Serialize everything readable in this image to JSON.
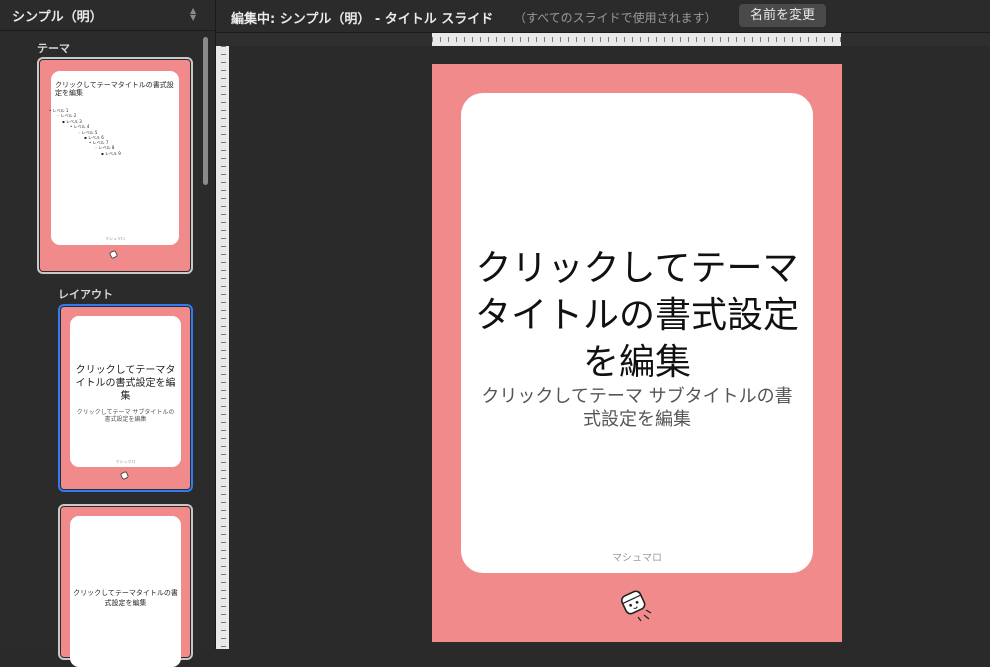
{
  "sidebar": {
    "theme_name": "シンプル（明）",
    "theme_section_label": "テーマ",
    "layout_section_label": "レイアウト",
    "thumbnails": [
      {
        "title": "クリックしてテーマタイトルの書式設定を編集",
        "levels": [
          "• レベル 1",
          "◦ レベル 2",
          "▪ レベル 3",
          "• レベル 4",
          "◦ レベル 5",
          "▪ レベル 6",
          "• レベル 7",
          "◦ レベル 8",
          "▪ レベル 9"
        ],
        "footer": "マシュマロ"
      },
      {
        "title": "クリックしてテーマタイトルの書式設定を編集",
        "subtitle": "クリックしてテーマ サブタイトルの書式設定を編集",
        "footer": "マシュマロ"
      },
      {
        "title": "クリックしてテーマタイトルの書式設定を編集"
      }
    ]
  },
  "topbar": {
    "editing_label": "編集中: シンプル（明） - タイトル スライド",
    "editing_note": "（すべてのスライドで使用されます）",
    "rename_label": "名前を変更"
  },
  "slide": {
    "title": "クリックしてテーマタイトルの書式設定を編集",
    "subtitle": "クリックしてテーマ サブタイトルの書式設定を編集",
    "footer": "マシュマロ"
  },
  "colors": {
    "slide_background": "#f08a8b",
    "selection_blue": "#2e7cf6",
    "app_background": "#2a2a2a"
  }
}
